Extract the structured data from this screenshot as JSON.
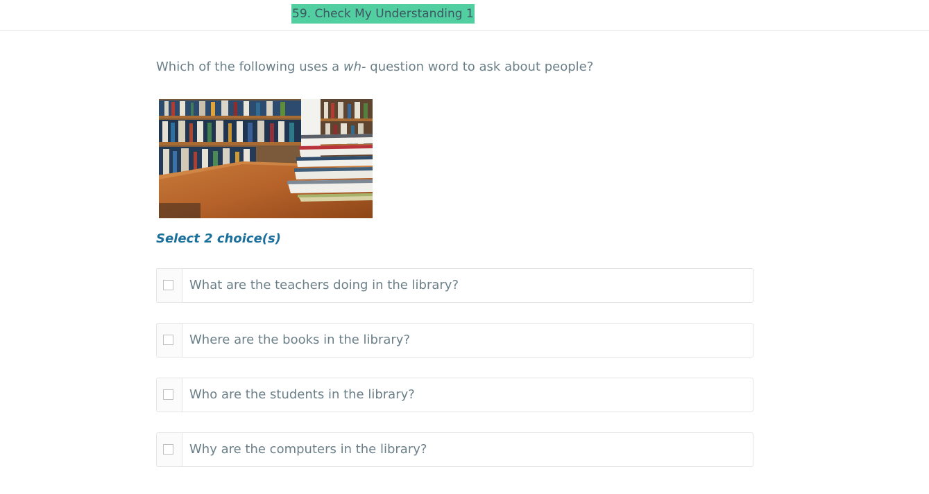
{
  "header": {
    "title": "59. Check My Understanding 1"
  },
  "question": {
    "prefix": "Which of the following uses a ",
    "emphasis": "wh-",
    "suffix": " question word to ask about people?"
  },
  "image": {
    "subject": "library-bookshelves-with-stacked-books-on-table"
  },
  "instruction": "Select 2 choice(s)",
  "choices": [
    {
      "label": "What are the teachers doing in the library?",
      "checked": false
    },
    {
      "label": "Where are the books in the library?",
      "checked": false
    },
    {
      "label": "Who are the students in the library?",
      "checked": false
    },
    {
      "label": "Why are the computers in the library?",
      "checked": false
    }
  ],
  "colors": {
    "header_highlight": "#52cfa1",
    "text": "#6b7f88",
    "instruction": "#1b6f9b",
    "border": "#e4e4e4"
  }
}
